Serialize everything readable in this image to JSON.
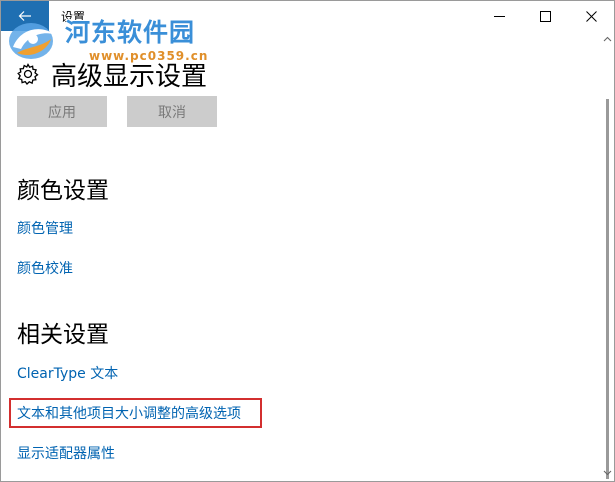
{
  "window": {
    "title": "设置",
    "back_icon": "arrow-left-icon",
    "controls": {
      "minimize_icon": "minimize-icon",
      "maximize_icon": "maximize-icon",
      "close_icon": "close-icon"
    }
  },
  "watermark": {
    "title": "河东软件园",
    "url": "www.pc0359.cn",
    "title_color": "#3a8fd8",
    "url_color": "#e08f2a"
  },
  "header": {
    "icon": "gear-icon",
    "title": "高级显示设置"
  },
  "actions": {
    "apply_label": "应用",
    "cancel_label": "取消"
  },
  "color_section": {
    "title": "颜色设置",
    "links": [
      "颜色管理",
      "颜色校准"
    ]
  },
  "related_section": {
    "title": "相关设置",
    "links": [
      "ClearType 文本",
      "文本和其他项目大小调整的高级选项",
      "显示适配器属性"
    ]
  },
  "colors": {
    "accent": "#0063b1",
    "back_button_bg": "#1f6fb2",
    "highlight_border": "#d32f2f",
    "disabled_button_bg": "#cccccc"
  }
}
